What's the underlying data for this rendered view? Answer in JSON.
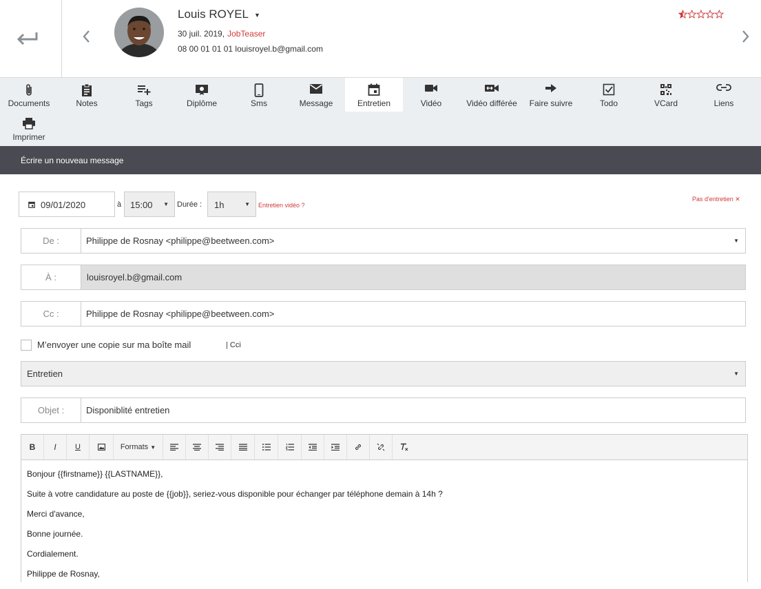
{
  "candidate": {
    "name": "Louis ROYEL",
    "date": "30 juil. 2019,",
    "source": "JobTeaser",
    "contact": "08 00 01 01 01 louisroyel.b@gmail.com",
    "rating": 0.5,
    "rating_max": 5
  },
  "toolbar": {
    "items": [
      {
        "label": "Documents",
        "icon": "paperclip-icon"
      },
      {
        "label": "Notes",
        "icon": "clipboard-icon"
      },
      {
        "label": "Tags",
        "icon": "playlist-add-icon"
      },
      {
        "label": "Diplôme",
        "icon": "certificate-icon"
      },
      {
        "label": "Sms",
        "icon": "phone-icon"
      },
      {
        "label": "Message",
        "icon": "envelope-icon"
      },
      {
        "label": "Entretien",
        "icon": "calendar-icon"
      },
      {
        "label": "Vidéo",
        "icon": "video-camera-icon"
      },
      {
        "label": "Vidéo différée",
        "icon": "deferred-video-icon"
      },
      {
        "label": "Faire suivre",
        "icon": "forward-arrow-icon"
      },
      {
        "label": "Todo",
        "icon": "checkbox-icon"
      },
      {
        "label": "VCard",
        "icon": "qr-code-icon"
      },
      {
        "label": "Liens",
        "icon": "link-icon"
      },
      {
        "label": "Imprimer",
        "icon": "printer-icon"
      }
    ],
    "active": "Entretien"
  },
  "section_title": "Écrire un nouveau message",
  "interview": {
    "date": "09/01/2020",
    "at_label": "à",
    "time": "15:00",
    "duration_label": "Durée :",
    "duration": "1h",
    "video_link": "Entretien vidéo ?",
    "no_interview": "Pas d'entretien ✕"
  },
  "fields": {
    "from_label": "De :",
    "from_value": "Philippe de Rosnay <philippe@beetween.com>",
    "to_label": "À :",
    "to_value": "louisroyel.b@gmail.com",
    "cc_label": "Cc :",
    "cc_value": "Philippe de Rosnay <philippe@beetween.com>",
    "copy_label": "M’envoyer une copie sur ma boîte mail",
    "cci_label": "| Cci",
    "template_value": "Entretien",
    "subject_label": "Objet :",
    "subject_value": "Disponiblité entretien"
  },
  "editor": {
    "formats_label": "Formats",
    "body": [
      "Bonjour {{firstname}} {{LASTNAME}},",
      "Suite à votre candidature au poste de {{job}}, seriez-vous disponible pour échanger par téléphone demain à 14h ?",
      "Merci d'avance,",
      "Bonne journée.",
      "Cordialement.",
      "Philippe de Rosnay,"
    ]
  },
  "colors": {
    "accent_red": "#d13a3a",
    "toolbar_bg": "#eceff1",
    "dark_bar": "#4a4a52"
  }
}
